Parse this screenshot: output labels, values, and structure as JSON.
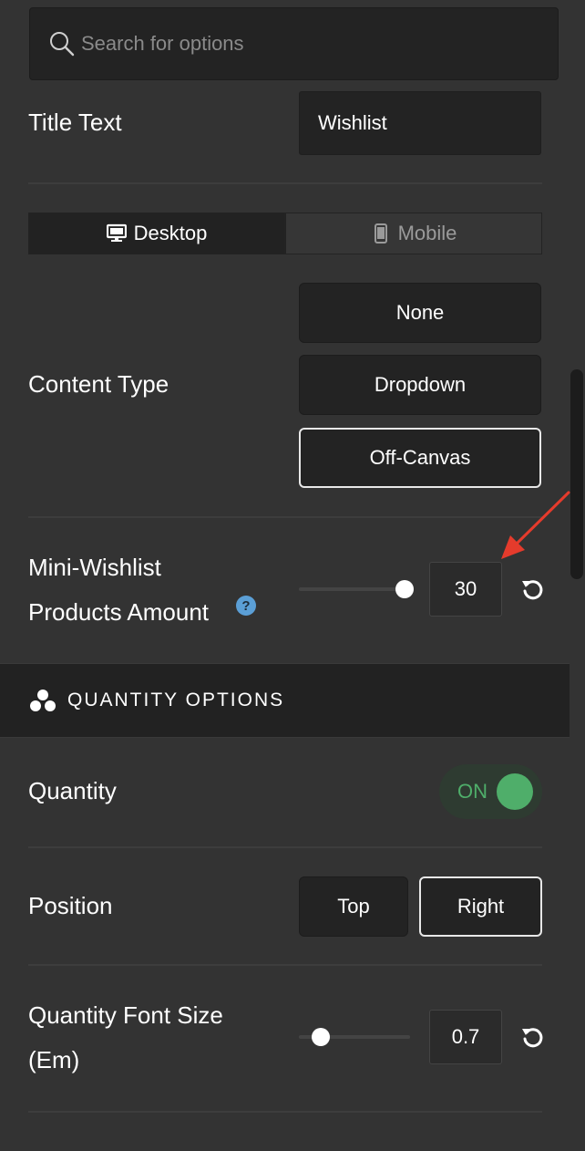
{
  "search": {
    "placeholder": "Search for options"
  },
  "title_text": {
    "label": "Title Text",
    "value": "Wishlist"
  },
  "device_tabs": {
    "desktop": "Desktop",
    "mobile": "Mobile",
    "active": "Desktop"
  },
  "content_type": {
    "label": "Content Type",
    "options": [
      "None",
      "Dropdown",
      "Off-Canvas"
    ],
    "selected": "Off-Canvas"
  },
  "mini_wishlist": {
    "label_line1": "Mini-Wishlist",
    "label_line2": "Products Amount",
    "help": "?",
    "value": "30",
    "slider_fraction": 0.95
  },
  "section": {
    "title": "QUANTITY OPTIONS",
    "icon": "circles-icon"
  },
  "quantity": {
    "label": "Quantity",
    "toggle_text": "ON",
    "enabled": true
  },
  "position": {
    "label": "Position",
    "options": [
      "Top",
      "Right"
    ],
    "selected": "Right"
  },
  "quantity_font_size": {
    "label_line1": "Quantity Font Size",
    "label_line2": "(Em)",
    "value": "0.7",
    "slider_fraction": 0.2
  },
  "colors": {
    "background": "#333333",
    "field": "#232323",
    "toggle_green": "#4fae6a",
    "help_blue": "#5b9fd6",
    "annotation_red": "#e53b2c"
  }
}
